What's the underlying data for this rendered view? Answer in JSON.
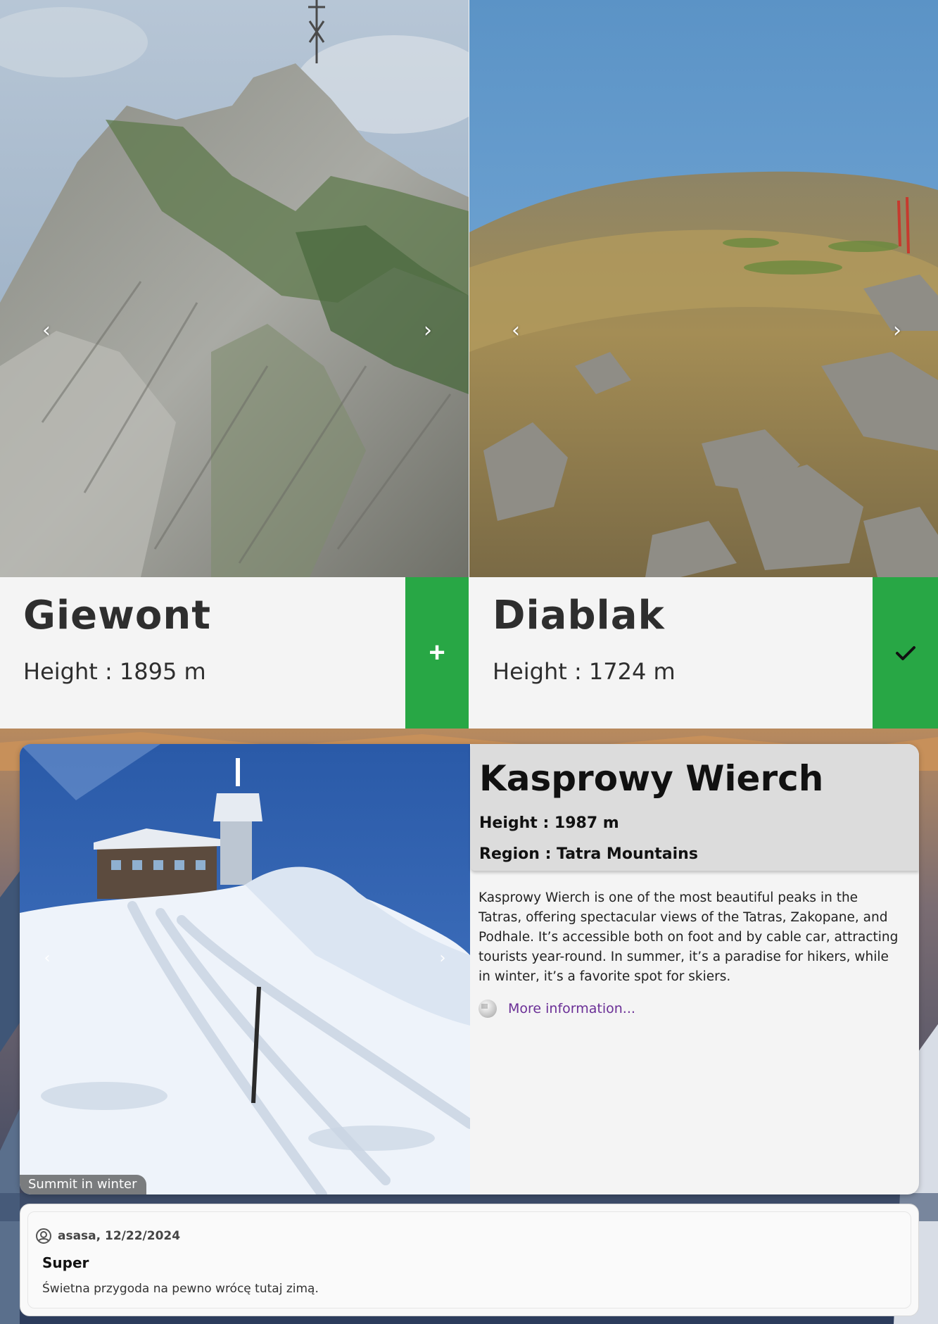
{
  "peaks": [
    {
      "name": "Giewont",
      "height_text": "Height : 1895 m",
      "action": "add",
      "action_glyph": "+",
      "action_icon": "plus-icon",
      "button_color": "#28a745"
    },
    {
      "name": "Diablak",
      "height_text": "Height : 1724 m",
      "action": "visited",
      "action_glyph": "✓",
      "action_icon": "check-icon",
      "button_color": "#28a745"
    }
  ],
  "carousel": {
    "prev_glyph": "‹",
    "next_glyph": "›"
  },
  "detail": {
    "name": "Kasprowy Wierch",
    "height_text": "Height : 1987 m",
    "region_text": "Region : Tatra Mountains",
    "description": "Kasprowy Wierch is one of the most beautiful peaks in the Tatras, offering spectacular views of the Tatras, Zakopane, and Podhale. It’s accessible both on foot and by cable car, attracting tourists year-round. In summer, it’s a paradise for hikers, while in winter, it’s a favorite spot for skiers.",
    "more_info_label": "More information...",
    "more_info_icon": "wikipedia-icon",
    "photo_caption": "Summit in winter"
  },
  "comments": [
    {
      "author_line": "asasa, 12/22/2024",
      "title": "Super",
      "text": "Świetna przygoda na pewno wrócę tutaj zimą."
    }
  ]
}
